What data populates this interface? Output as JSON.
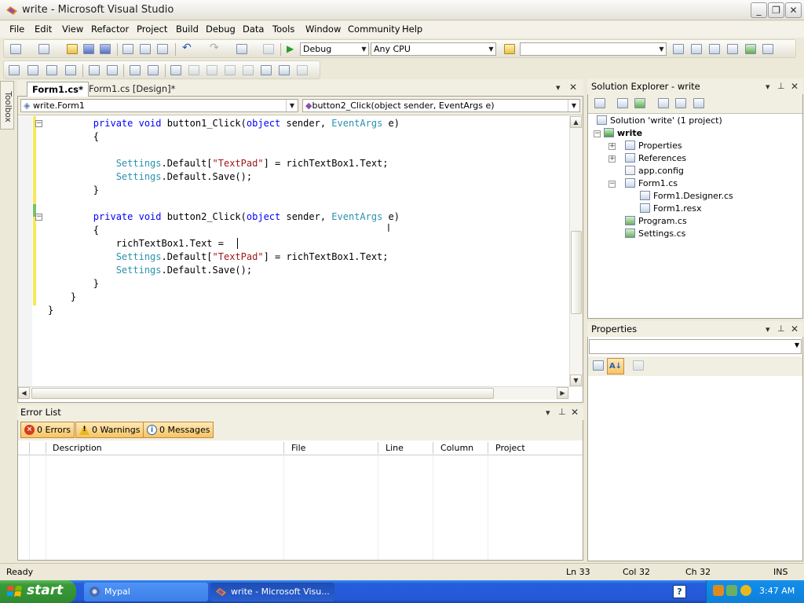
{
  "window": {
    "title": "write - Microsoft Visual Studio"
  },
  "menu": [
    "File",
    "Edit",
    "View",
    "Refactor",
    "Project",
    "Build",
    "Debug",
    "Data",
    "Tools",
    "Window",
    "Community",
    "Help"
  ],
  "toolbar": {
    "configuration": "Debug",
    "platform": "Any CPU",
    "find_value": ""
  },
  "toolbox_label": "Toolbox",
  "doc_tabs": [
    {
      "label": "Form1.cs*",
      "active": true
    },
    {
      "label": "Form1.cs [Design]*",
      "active": false
    }
  ],
  "nav": {
    "type_combo": "write.Form1",
    "member_combo": "button2_Click(object sender, EventArgs e)"
  },
  "code_lines": [
    "        private void button1_Click(object sender, EventArgs e)",
    "        {",
    "",
    "            Settings.Default[\"TextPad\"] = richTextBox1.Text;",
    "            Settings.Default.Save();",
    "        }",
    "",
    "        private void button2_Click(object sender, EventArgs e)",
    "        {",
    "            richTextBox1.Text =",
    "            Settings.Default[\"TextPad\"] = richTextBox1.Text;",
    "            Settings.Default.Save();",
    "        }",
    "    }",
    "}"
  ],
  "error_list": {
    "title": "Error List",
    "errors": "0 Errors",
    "warnings": "0 Warnings",
    "messages": "0 Messages",
    "columns": [
      "Description",
      "File",
      "Line",
      "Column",
      "Project"
    ]
  },
  "solution_explorer": {
    "title": "Solution Explorer - write",
    "items": [
      {
        "label": "Solution 'write' (1 project)"
      },
      {
        "label": "write"
      },
      {
        "label": "Properties"
      },
      {
        "label": "References"
      },
      {
        "label": "app.config"
      },
      {
        "label": "Form1.cs"
      },
      {
        "label": "Form1.Designer.cs"
      },
      {
        "label": "Form1.resx"
      },
      {
        "label": "Program.cs"
      },
      {
        "label": "Settings.cs"
      }
    ]
  },
  "properties": {
    "title": "Properties"
  },
  "status": {
    "text": "Ready",
    "ln": "Ln 33",
    "col": "Col 32",
    "ch": "Ch 32",
    "mode": "INS"
  },
  "taskbar": {
    "start": "start",
    "tasks": [
      "Mypal",
      "write - Microsoft Visu..."
    ],
    "clock": "3:47 AM"
  },
  "colors": {
    "keyword": "#0000ff",
    "type": "#2b91af",
    "string": "#a31515",
    "taskbar": "#245edb"
  }
}
